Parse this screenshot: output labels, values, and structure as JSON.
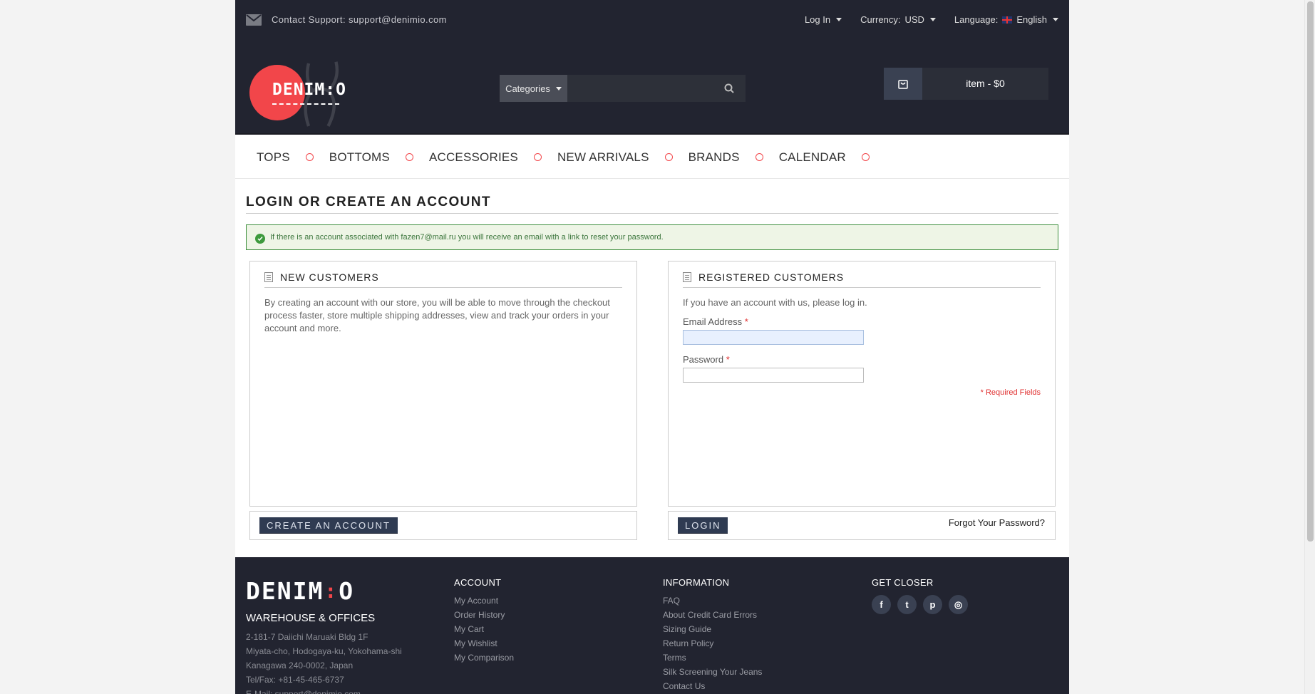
{
  "topbar": {
    "support": "Contact Support: support@denimio.com",
    "login": "Log In",
    "currency_label": "Currency:",
    "currency_value": "USD",
    "language_label": "Language:",
    "language_value": "English"
  },
  "header": {
    "logo_text": "DENIM:O",
    "search": {
      "category_label": "Categories",
      "placeholder": ""
    },
    "cart_label": "item - $0"
  },
  "nav": [
    "TOPS",
    "BOTTOMS",
    "ACCESSORIES",
    "NEW ARRIVALS",
    "BRANDS",
    "CALENDAR"
  ],
  "main": {
    "title": "Login or Create an Account",
    "success_message": "If there is an account associated with fazen7@mail.ru you will receive an email with a link to reset your password.",
    "new_customers": {
      "title": "New Customers",
      "text": "By creating an account with our store, you will be able to move through the checkout process faster, store multiple shipping addresses, view and track your orders in your account and more.",
      "button": "Create an Account"
    },
    "registered": {
      "title": "Registered Customers",
      "text": "If you have an account with us, please log in.",
      "email_label": "Email Address",
      "email_value": "",
      "password_label": "Password",
      "password_value": "",
      "required_mark": "*",
      "required_note": "* Required Fields",
      "button": "Login",
      "forgot": "Forgot Your Password?"
    }
  },
  "footer": {
    "logo_left": "DENIM",
    "logo_mid": ":",
    "logo_right": "O",
    "warehouse_title": "WAREHOUSE & OFFICES",
    "address": [
      "2-181-7 Daiichi Maruaki Bldg 1F",
      "Miyata-cho, Hodogaya-ku, Yokohama-shi",
      "Kanagawa 240-0002, Japan",
      "Tel/Fax: +81-45-465-6737",
      "E-Mail: support@denimio.com"
    ],
    "account_title": "ACCOUNT",
    "account_links": [
      "My Account",
      "Order History",
      "My Cart",
      "My Wishlist",
      "My Comparison"
    ],
    "info_title": "INFORMATION",
    "info_links": [
      "FAQ",
      "About Credit Card Errors",
      "Sizing Guide",
      "Return Policy",
      "Terms",
      "Silk Screening Your Jeans",
      "Contact Us"
    ],
    "closer_title": "GET CLOSER",
    "social": [
      {
        "icon": "facebook-icon",
        "glyph": "f"
      },
      {
        "icon": "twitter-icon",
        "glyph": "t"
      },
      {
        "icon": "pinterest-icon",
        "glyph": "p"
      },
      {
        "icon": "instagram-icon",
        "glyph": "◎"
      }
    ]
  },
  "colors": {
    "dark": "#222430",
    "accent": "#f2464a",
    "button": "#2f3b52",
    "success_border": "#3d8f3d"
  }
}
